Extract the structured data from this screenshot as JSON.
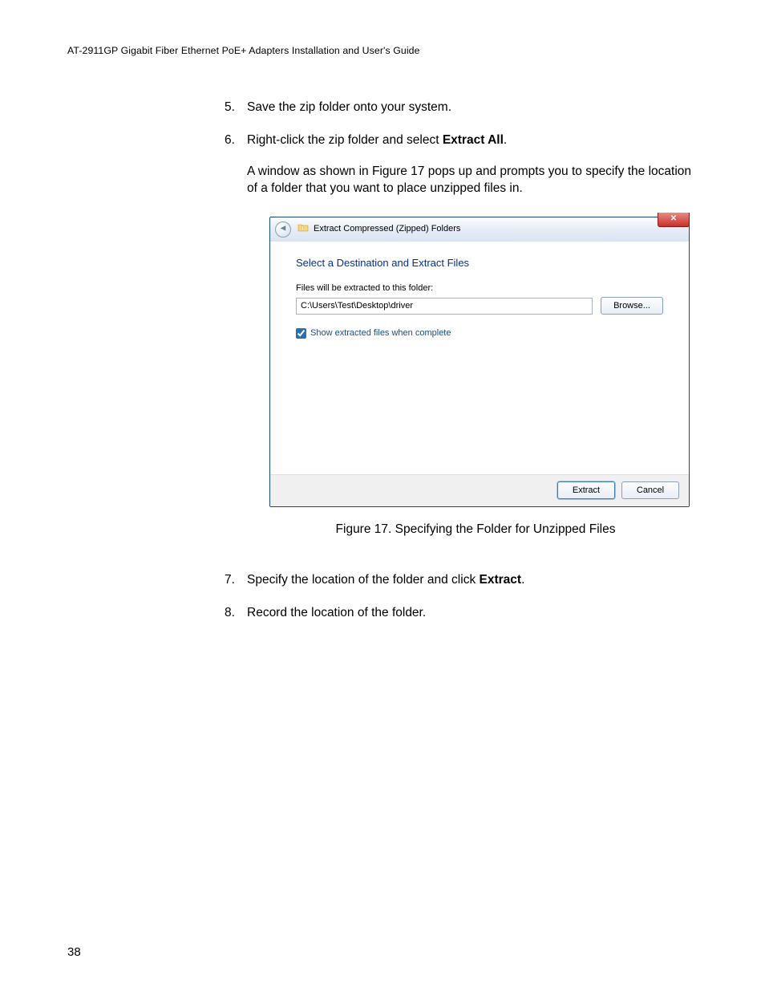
{
  "header": "AT-2911GP Gigabit Fiber Ethernet PoE+ Adapters Installation and User's Guide",
  "steps": {
    "s5": {
      "num": "5.",
      "text": "Save the zip folder onto your system."
    },
    "s6": {
      "num": "6.",
      "text_a": "Right-click the zip folder and select ",
      "text_b": "Extract All",
      "text_c": ".",
      "para2": "A window as shown in Figure 17 pops up and prompts you to specify the location of a folder that you want to place unzipped files in."
    },
    "s7": {
      "num": "7.",
      "text_a": "Specify the location of the folder and click ",
      "text_b": "Extract",
      "text_c": "."
    },
    "s8": {
      "num": "8.",
      "text": "Record the location of the folder."
    }
  },
  "figure_caption": "Figure 17. Specifying the Folder for Unzipped Files",
  "dialog": {
    "title": "Extract Compressed (Zipped) Folders",
    "instruction": "Select a Destination and Extract Files",
    "label": "Files will be extracted to this folder:",
    "path": "C:\\Users\\Test\\Desktop\\driver",
    "browse": "Browse...",
    "checkbox": "Show extracted files when complete",
    "extract": "Extract",
    "cancel": "Cancel",
    "close": "✕"
  },
  "page_number": "38"
}
